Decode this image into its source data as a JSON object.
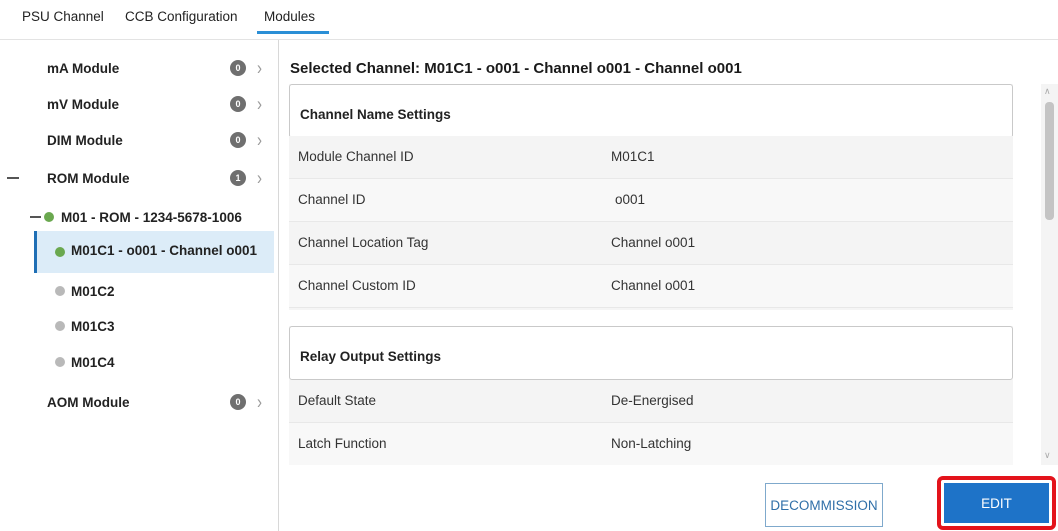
{
  "tabs": [
    {
      "label": "PSU Channel",
      "active": false
    },
    {
      "label": "CCB Configuration",
      "active": false
    },
    {
      "label": "Modules",
      "active": true
    }
  ],
  "tree": {
    "modules": [
      {
        "label": "mA Module",
        "count": "0"
      },
      {
        "label": "mV Module",
        "count": "0"
      },
      {
        "label": "DIM Module",
        "count": "0"
      },
      {
        "label": "ROM Module",
        "count": "1",
        "expanded": true
      },
      {
        "label": "AOM Module",
        "count": "0"
      }
    ],
    "device": {
      "label": "M01 - ROM - 1234-5678-1006",
      "status": "green"
    },
    "channels": [
      {
        "label": "M01C1 - o001 - Channel o001",
        "status": "green",
        "selected": true
      },
      {
        "label": "M01C2",
        "status": "gray"
      },
      {
        "label": "M01C3",
        "status": "gray"
      },
      {
        "label": "M01C4",
        "status": "gray"
      }
    ]
  },
  "details": {
    "selected_title": "Selected Channel: M01C1 - o001 - Channel o001 - Channel o001",
    "sections": [
      {
        "title": "Channel Name Settings",
        "rows": [
          {
            "key": "Module Channel ID",
            "value": "M01C1"
          },
          {
            "key": "Channel ID",
            "value": "o001"
          },
          {
            "key": "Channel Location Tag",
            "value": "Channel o001"
          },
          {
            "key": "Channel Custom ID",
            "value": "Channel o001"
          }
        ]
      },
      {
        "title": "Relay Output Settings",
        "rows": [
          {
            "key": "Default State",
            "value": "De-Energised"
          },
          {
            "key": "Latch Function",
            "value": "Non-Latching"
          }
        ]
      }
    ]
  },
  "buttons": {
    "decommission": "DECOMMISSION",
    "edit": "EDIT"
  },
  "colors": {
    "accent": "#1e73c8",
    "tab_underline": "#2b8fd6",
    "highlight_border": "#e3131b",
    "status_green": "#6aa84f",
    "status_gray": "#b9b9b9",
    "selected_bg": "#dcecf8"
  },
  "icons": {
    "chevron": "chevron-right-icon",
    "collapse": "collapse-dash-icon",
    "status": "status-dot-icon"
  }
}
